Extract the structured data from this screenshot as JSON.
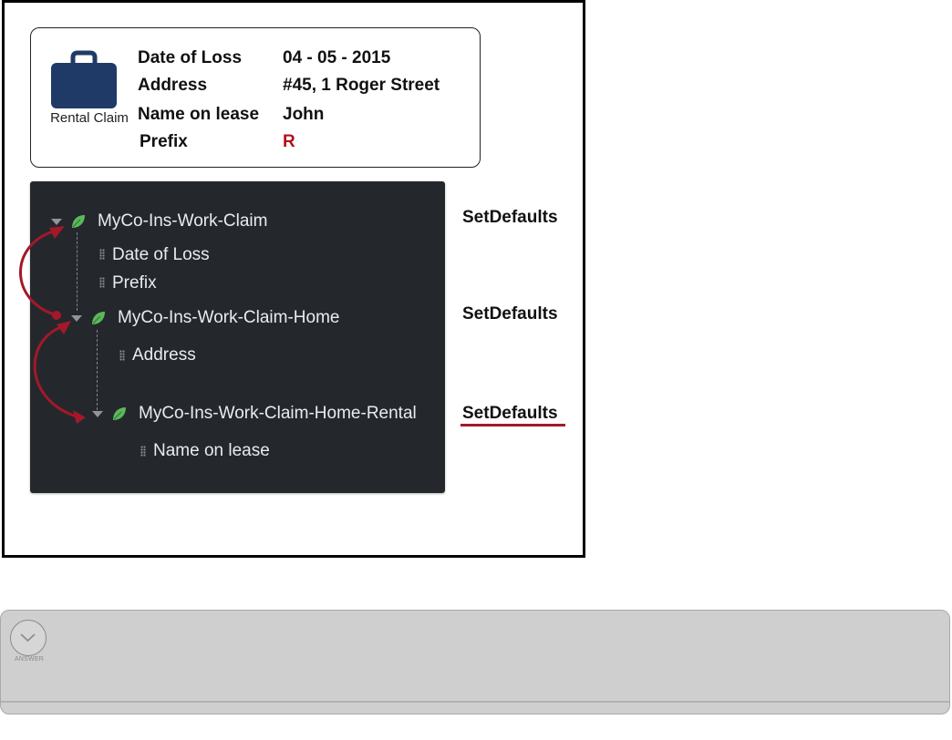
{
  "claim_card": {
    "icon": "briefcase-icon",
    "icon_label": "Rental Claim",
    "fields": [
      {
        "label": "Date of Loss",
        "value": "04 - 05 - 2015"
      },
      {
        "label": "Address",
        "value": "#45, 1 Roger Street"
      },
      {
        "label": "Name on lease",
        "value": "John"
      },
      {
        "label": "Prefix",
        "value": "R"
      }
    ],
    "prefix_value_color": "#b3101e"
  },
  "tree": {
    "background": "#24282c",
    "leaf_color": "#5cb85c",
    "nodes": [
      {
        "title": "MyCo-Ins-Work-Claim",
        "properties": [
          "Date of Loss",
          "Prefix"
        ],
        "action": "SetDefaults"
      },
      {
        "title": "MyCo-Ins-Work-Claim-Home",
        "properties": [
          "Address"
        ],
        "action": "SetDefaults"
      },
      {
        "title": "MyCo-Ins-Work-Claim-Home-Rental",
        "properties": [
          "Name on lease"
        ],
        "action": "SetDefaults"
      }
    ],
    "arrow_color": "#a3182a"
  },
  "answer_panel": {
    "button_icon": "chevron-down-icon",
    "button_label": "ANSWER"
  }
}
